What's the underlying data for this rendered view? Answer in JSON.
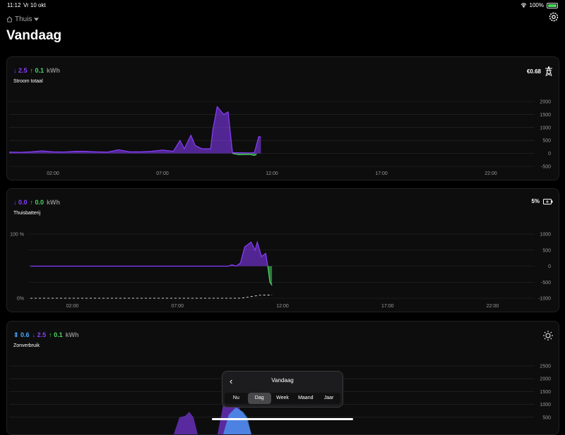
{
  "status": {
    "time": "11:12",
    "date": "Vr 10 okt",
    "battery": "100%"
  },
  "location": {
    "label": "Thuis"
  },
  "page_title": "Vandaag",
  "cards": [
    {
      "down": "↓ 2.5",
      "up": "↑ 0.1",
      "unit": "kWh",
      "subtitle": "Stroom totaal",
      "right_value": "€0.68",
      "right_icon": "power-pylon-icon",
      "chart_data": {
        "type": "area",
        "x_ticks": [
          "02:00",
          "07:00",
          "12:00",
          "17:00",
          "22:00"
        ],
        "y_ticks": [
          "2000",
          "1500",
          "1000",
          "500",
          "0",
          "-500"
        ],
        "ylim": [
          -500,
          2000
        ],
        "xlim_hours": [
          0,
          24
        ],
        "series": [
          {
            "color": "#8b3dff",
            "points": [
              [
                0,
                50
              ],
              [
                0.5,
                40
              ],
              [
                1,
                60
              ],
              [
                1.5,
                100
              ],
              [
                2,
                60
              ],
              [
                2.5,
                55
              ],
              [
                3,
                80
              ],
              [
                3.5,
                80
              ],
              [
                4,
                60
              ],
              [
                4.5,
                50
              ],
              [
                5,
                140
              ],
              [
                5.5,
                60
              ],
              [
                6,
                60
              ],
              [
                6.5,
                80
              ],
              [
                7,
                130
              ],
              [
                7.5,
                80
              ],
              [
                7.8,
                500
              ],
              [
                8,
                180
              ],
              [
                8.3,
                700
              ],
              [
                8.5,
                300
              ],
              [
                8.8,
                180
              ],
              [
                9.2,
                180
              ],
              [
                9.3,
                900
              ],
              [
                9.5,
                1800
              ],
              [
                9.8,
                1500
              ],
              [
                10,
                1600
              ],
              [
                10.2,
                30
              ],
              [
                11,
                20
              ],
              [
                11.2,
                30
              ],
              [
                11.4,
                650
              ],
              [
                11.5,
                620
              ]
            ]
          },
          {
            "color": "#4cd964",
            "points": [
              [
                10.2,
                0
              ],
              [
                10.5,
                -50
              ],
              [
                11,
                -40
              ],
              [
                11.2,
                -80
              ],
              [
                11.3,
                -30
              ]
            ]
          }
        ]
      }
    },
    {
      "down": "↓ 0.0",
      "up": "↑ 0.0",
      "unit": "kWh",
      "subtitle": "Thuisbatterij",
      "right_value": "5%",
      "right_icon": "battery-icon",
      "chart_data": {
        "type": "area",
        "x_ticks": [
          "02:00",
          "07:00",
          "12:00",
          "17:00",
          "22:00"
        ],
        "y_ticks": [
          "1000",
          "500",
          "0",
          "-500",
          "-1000"
        ],
        "left_ticks": [
          "100 %",
          "0%"
        ],
        "ylim": [
          -1000,
          1000
        ],
        "xlim_hours": [
          0,
          24
        ],
        "series": [
          {
            "color": "#8b3dff",
            "points": [
              [
                0,
                0
              ],
              [
                9.4,
                0
              ],
              [
                9.6,
                40
              ],
              [
                9.8,
                0
              ],
              [
                10,
                100
              ],
              [
                10.2,
                600
              ],
              [
                10.5,
                750
              ],
              [
                10.7,
                500
              ],
              [
                10.8,
                750
              ],
              [
                11,
                300
              ],
              [
                11.2,
                400
              ],
              [
                11.3,
                0
              ]
            ]
          },
          {
            "color": "#4cd964",
            "points": [
              [
                11.3,
                0
              ],
              [
                11.4,
                -500
              ],
              [
                11.5,
                -600
              ]
            ]
          }
        ],
        "soc_percent": [
          [
            0,
            0
          ],
          [
            10,
            0
          ],
          [
            10.6,
            3
          ],
          [
            11,
            5
          ],
          [
            11.5,
            5
          ]
        ]
      }
    },
    {
      "both": "⇕ 0.6",
      "down": "↓ 2.5",
      "up": "↑ 0.1",
      "unit": "kWh",
      "subtitle": "Zonverbruik",
      "right_icon": "sun-icon",
      "chart_data": {
        "type": "area",
        "y_ticks": [
          "2500",
          "2000",
          "1500",
          "1000",
          "500"
        ],
        "ylim": [
          0,
          2500
        ]
      }
    }
  ],
  "picker": {
    "title": "Vandaag",
    "options": [
      "Nu",
      "Dag",
      "Week",
      "Maand",
      "Jaar"
    ],
    "selected": "Dag"
  }
}
